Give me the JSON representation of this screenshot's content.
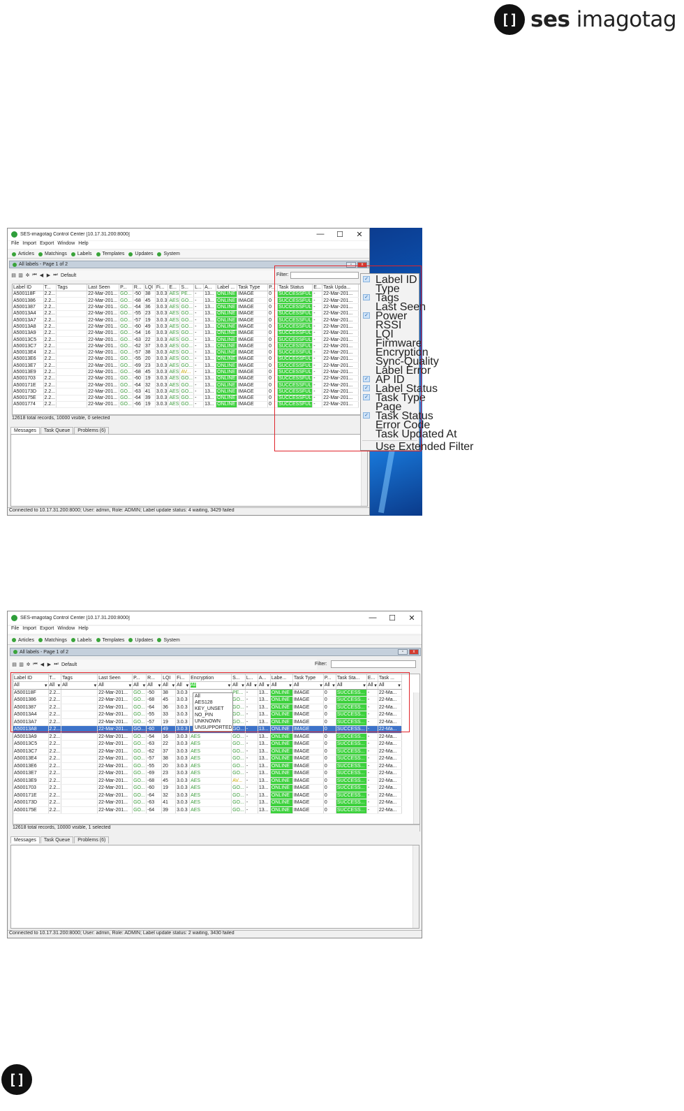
{
  "brand": {
    "mark": "[]",
    "name_bold": "ses",
    "name_rest": " imagotag"
  },
  "window": {
    "title_1": "SES-imagotag Control Center [10.17.31.200:8000]",
    "title_2": "SES-imagotag Control Center [10.17.31.200:8000]",
    "controls": [
      "—",
      "☐",
      "✕"
    ]
  },
  "menu": [
    "File",
    "Import",
    "Export",
    "Window",
    "Help"
  ],
  "nav": [
    "Articles",
    "Matchings",
    "Labels",
    "Templates",
    "Updates",
    "System"
  ],
  "panel": {
    "title": "All labels - Page 1 of 2",
    "filter_label": "Filter:",
    "toolbar_default": "Default"
  },
  "shot1": {
    "columns": [
      "Label ID",
      "T...",
      "Tags",
      "Last Seen",
      "P...",
      "R...",
      "LQI",
      "Fi...",
      "E...",
      "S...",
      "L...",
      "A...",
      "Label ...",
      "Task Type",
      "P...",
      "Task Status",
      "E...",
      "Task Upda..."
    ],
    "rows": [
      [
        "A500118F",
        "2.2...",
        "",
        "22-Mar-201...",
        "GO...",
        "-50",
        "38",
        "3.0.3",
        "AES",
        "PE...",
        "-",
        "13...",
        "ONLINE",
        "IMAGE",
        "0",
        "SUCCESSFUL",
        "-",
        "22-Mar-201..."
      ],
      [
        "A5001386",
        "2.2...",
        "",
        "22-Mar-201...",
        "GO...",
        "-68",
        "45",
        "3.0.3",
        "AES",
        "GO...",
        "-",
        "13...",
        "ONLINE",
        "IMAGE",
        "0",
        "SUCCESSFUL",
        "-",
        "22-Mar-201..."
      ],
      [
        "A5001387",
        "2.2...",
        "",
        "22-Mar-201...",
        "GO...",
        "-64",
        "36",
        "3.0.3",
        "AES",
        "GO...",
        "-",
        "13...",
        "ONLINE",
        "IMAGE",
        "0",
        "SUCCESSFUL",
        "-",
        "22-Mar-201..."
      ],
      [
        "A50013A4",
        "2.2...",
        "",
        "22-Mar-201...",
        "GO...",
        "-55",
        "23",
        "3.0.3",
        "AES",
        "GO...",
        "-",
        "13...",
        "ONLINE",
        "IMAGE",
        "0",
        "SUCCESSFUL",
        "-",
        "22-Mar-201..."
      ],
      [
        "A50013A7",
        "2.2...",
        "",
        "22-Mar-201...",
        "GO...",
        "-57",
        "19",
        "3.0.3",
        "AES",
        "GO...",
        "-",
        "13...",
        "ONLINE",
        "IMAGE",
        "0",
        "SUCCESSFUL",
        "-",
        "22-Mar-201..."
      ],
      [
        "A50013A8",
        "2.2...",
        "",
        "22-Mar-201...",
        "GO...",
        "-60",
        "49",
        "3.0.3",
        "AES",
        "GO...",
        "-",
        "13...",
        "ONLINE",
        "IMAGE",
        "0",
        "SUCCESSFUL",
        "-",
        "22-Mar-201..."
      ],
      [
        "A50013A9",
        "2.2...",
        "",
        "22-Mar-201...",
        "GO...",
        "-54",
        "16",
        "3.0.3",
        "AES",
        "GO...",
        "-",
        "13...",
        "ONLINE",
        "IMAGE",
        "0",
        "SUCCESSFUL",
        "-",
        "22-Mar-201..."
      ],
      [
        "A50013C5",
        "2.2...",
        "",
        "22-Mar-201...",
        "GO...",
        "-63",
        "22",
        "3.0.3",
        "AES",
        "GO...",
        "-",
        "13...",
        "ONLINE",
        "IMAGE",
        "0",
        "SUCCESSFUL",
        "-",
        "22-Mar-201..."
      ],
      [
        "A50013C7",
        "2.2...",
        "",
        "22-Mar-201...",
        "GO...",
        "-62",
        "37",
        "3.0.3",
        "AES",
        "GO...",
        "-",
        "13...",
        "ONLINE",
        "IMAGE",
        "0",
        "SUCCESSFUL",
        "-",
        "22-Mar-201..."
      ],
      [
        "A50013E4",
        "2.2...",
        "",
        "22-Mar-201...",
        "GO...",
        "-57",
        "38",
        "3.0.3",
        "AES",
        "GO...",
        "-",
        "13...",
        "ONLINE",
        "IMAGE",
        "0",
        "SUCCESSFUL",
        "-",
        "22-Mar-201..."
      ],
      [
        "A50013E6",
        "2.2...",
        "",
        "22-Mar-201...",
        "GO...",
        "-55",
        "20",
        "3.0.3",
        "AES",
        "GO...",
        "-",
        "13...",
        "ONLINE",
        "IMAGE",
        "0",
        "SUCCESSFUL",
        "-",
        "22-Mar-201..."
      ],
      [
        "A50013E7",
        "2.2...",
        "",
        "22-Mar-201...",
        "GO...",
        "-69",
        "23",
        "3.0.3",
        "AES",
        "GO...",
        "-",
        "13...",
        "ONLINE",
        "IMAGE",
        "0",
        "SUCCESSFUL",
        "-",
        "22-Mar-201..."
      ],
      [
        "A50013E9",
        "2.2...",
        "",
        "22-Mar-201...",
        "GO...",
        "-68",
        "45",
        "3.0.3",
        "AES",
        "AV...",
        "-",
        "13...",
        "ONLINE",
        "IMAGE",
        "0",
        "SUCCESSFUL",
        "-",
        "22-Mar-201..."
      ],
      [
        "A5001703",
        "2.2...",
        "",
        "22-Mar-201...",
        "GO...",
        "-60",
        "19",
        "3.0.3",
        "AES",
        "GO...",
        "-",
        "13...",
        "ONLINE",
        "IMAGE",
        "0",
        "SUCCESSFUL",
        "-",
        "22-Mar-201..."
      ],
      [
        "A500171E",
        "2.2...",
        "",
        "22-Mar-201...",
        "GO...",
        "-64",
        "32",
        "3.0.3",
        "AES",
        "GO...",
        "-",
        "13...",
        "ONLINE",
        "IMAGE",
        "0",
        "SUCCESSFUL",
        "-",
        "22-Mar-201..."
      ],
      [
        "A500173D",
        "2.2...",
        "",
        "22-Mar-201...",
        "GO...",
        "-63",
        "41",
        "3.0.3",
        "AES",
        "GO...",
        "-",
        "13...",
        "ONLINE",
        "IMAGE",
        "0",
        "SUCCESSFUL",
        "-",
        "22-Mar-201..."
      ],
      [
        "A500175E",
        "2.2...",
        "",
        "22-Mar-201...",
        "GO...",
        "-64",
        "39",
        "3.0.3",
        "AES",
        "GO...",
        "-",
        "13...",
        "ONLINE",
        "IMAGE",
        "0",
        "SUCCESSFUL",
        "-",
        "22-Mar-201..."
      ],
      [
        "A5001774",
        "2.2...",
        "",
        "22-Mar-201...",
        "GO...",
        "-66",
        "19",
        "3.0.3",
        "AES",
        "GO...",
        "-",
        "13...",
        "ONLINE",
        "IMAGE",
        "0",
        "SUCCESSFUL",
        "-",
        "22-Mar-201..."
      ]
    ],
    "records": "12618 total records, 10000 visible, 0 selected",
    "status": "Connected to 10.17.31.200:8000; User: admin, Role: ADMIN; Label update status: 4 waiting, 3429 failed",
    "column_menu": [
      {
        "label": "Label ID",
        "checked": true
      },
      {
        "label": "Type",
        "checked": false
      },
      {
        "label": "Tags",
        "checked": true
      },
      {
        "label": "Last Seen",
        "checked": false
      },
      {
        "label": "Power",
        "checked": true
      },
      {
        "label": "RSSI",
        "checked": false
      },
      {
        "label": "LQI",
        "checked": false
      },
      {
        "label": "Firmware",
        "checked": false
      },
      {
        "label": "Encryption",
        "checked": false
      },
      {
        "label": "Sync-Quality",
        "checked": false
      },
      {
        "label": "Label Error",
        "checked": false
      },
      {
        "label": "AP ID",
        "checked": true
      },
      {
        "label": "Label Status",
        "checked": true
      },
      {
        "label": "Task Type",
        "checked": true
      },
      {
        "label": "Page",
        "checked": false
      },
      {
        "label": "Task Status",
        "checked": true
      },
      {
        "label": "Error Code",
        "checked": false
      },
      {
        "label": "Task Updated At",
        "checked": false
      }
    ],
    "column_menu_extra": "Use Extended Filter"
  },
  "shot2": {
    "columns": [
      "Label ID",
      "T...",
      "Tags",
      "Last Seen",
      "P...",
      "R...",
      "LQI",
      "Fi...",
      "Encryption",
      "S...",
      "L...",
      "A...",
      "Labe...",
      "Task Type",
      "P...",
      "Task Sta...",
      "E...",
      "Task ..."
    ],
    "filter_value": "All",
    "encryption_options": [
      "All",
      "AES128",
      "KEY_UNSET",
      "NO_PIN",
      "UNKNOWN",
      "UNSUPPORTED"
    ],
    "rows": [
      [
        "A500118F",
        "2.2...",
        "",
        "22-Mar-201...",
        "GO...",
        "-50",
        "38",
        "3.0.3",
        "",
        "PE...",
        "-",
        "13...",
        "ONLINE",
        "IMAGE",
        "0",
        "SUCCESS...",
        "-",
        "22-Ma..."
      ],
      [
        "A5001386",
        "2.2...",
        "",
        "22-Mar-201...",
        "GO...",
        "-68",
        "45",
        "3.0.3",
        "",
        "GO...",
        "-",
        "13...",
        "ONLINE",
        "IMAGE",
        "0",
        "SUCCESS...",
        "-",
        "22-Ma..."
      ],
      [
        "A5001387",
        "2.2...",
        "",
        "22-Mar-201...",
        "GO...",
        "-64",
        "36",
        "3.0.3",
        "",
        "GO...",
        "-",
        "13...",
        "ONLINE",
        "IMAGE",
        "0",
        "SUCCESS...",
        "-",
        "22-Ma..."
      ],
      [
        "A50013A4",
        "2.2...",
        "",
        "22-Mar-201...",
        "GO...",
        "-55",
        "33",
        "3.0.3",
        "",
        "GO...",
        "-",
        "13...",
        "ONLINE",
        "IMAGE",
        "0",
        "SUCCESS...",
        "-",
        "22-Ma..."
      ],
      [
        "A50013A7",
        "2.2...",
        "",
        "22-Mar-201...",
        "GO...",
        "-57",
        "19",
        "3.0.3",
        "",
        "GO...",
        "-",
        "13...",
        "ONLINE",
        "IMAGE",
        "0",
        "SUCCESS...",
        "-",
        "22-Ma..."
      ],
      [
        "A50013A8",
        "2.2...",
        "",
        "22-Mar-201...",
        "GO...",
        "-60",
        "49",
        "3.0.3",
        "",
        "GO...",
        "-",
        "13...",
        "ONLINE",
        "IMAGE",
        "0",
        "SUCCESS...",
        "-",
        "22-Ma..."
      ],
      [
        "A50013A9",
        "2.2...",
        "",
        "22-Mar-201...",
        "GO...",
        "-54",
        "16",
        "3.0.3",
        "AES",
        "GO...",
        "-",
        "13...",
        "ONLINE",
        "IMAGE",
        "0",
        "SUCCESS...",
        "-",
        "22-Ma..."
      ],
      [
        "A50013C5",
        "2.2...",
        "",
        "22-Mar-201...",
        "GO...",
        "-63",
        "22",
        "3.0.3",
        "AES",
        "GO...",
        "-",
        "13...",
        "ONLINE",
        "IMAGE",
        "0",
        "SUCCESS...",
        "-",
        "22-Ma..."
      ],
      [
        "A50013C7",
        "2.2...",
        "",
        "22-Mar-201...",
        "GO...",
        "-62",
        "37",
        "3.0.3",
        "AES",
        "GO...",
        "-",
        "13...",
        "ONLINE",
        "IMAGE",
        "0",
        "SUCCESS...",
        "-",
        "22-Ma..."
      ],
      [
        "A50013E4",
        "2.2...",
        "",
        "22-Mar-201...",
        "GO...",
        "-57",
        "38",
        "3.0.3",
        "AES",
        "GO...",
        "-",
        "13...",
        "ONLINE",
        "IMAGE",
        "0",
        "SUCCESS...",
        "-",
        "22-Ma..."
      ],
      [
        "A50013E6",
        "2.2...",
        "",
        "22-Mar-201...",
        "GO...",
        "-55",
        "20",
        "3.0.3",
        "AES",
        "GO...",
        "-",
        "13...",
        "ONLINE",
        "IMAGE",
        "0",
        "SUCCESS...",
        "-",
        "22-Ma..."
      ],
      [
        "A50013E7",
        "2.2...",
        "",
        "22-Mar-201...",
        "GO...",
        "-69",
        "23",
        "3.0.3",
        "AES",
        "GO...",
        "-",
        "13...",
        "ONLINE",
        "IMAGE",
        "0",
        "SUCCESS...",
        "-",
        "22-Ma..."
      ],
      [
        "A50013E9",
        "2.2...",
        "",
        "22-Mar-201...",
        "GO...",
        "-68",
        "45",
        "3.0.3",
        "AES",
        "AV...",
        "-",
        "13...",
        "ONLINE",
        "IMAGE",
        "0",
        "SUCCESS...",
        "-",
        "22-Ma..."
      ],
      [
        "A5001703",
        "2.2...",
        "",
        "22-Mar-201...",
        "GO...",
        "-60",
        "19",
        "3.0.3",
        "AES",
        "GO...",
        "-",
        "13...",
        "ONLINE",
        "IMAGE",
        "0",
        "SUCCESS...",
        "-",
        "22-Ma..."
      ],
      [
        "A500171E",
        "2.2...",
        "",
        "22-Mar-201...",
        "GO...",
        "-64",
        "32",
        "3.0.3",
        "AES",
        "GO...",
        "-",
        "13...",
        "ONLINE",
        "IMAGE",
        "0",
        "SUCCESS...",
        "-",
        "22-Ma..."
      ],
      [
        "A500173D",
        "2.2...",
        "",
        "22-Mar-201...",
        "GO...",
        "-63",
        "41",
        "3.0.3",
        "AES",
        "GO...",
        "-",
        "13...",
        "ONLINE",
        "IMAGE",
        "0",
        "SUCCESS...",
        "-",
        "22-Ma..."
      ],
      [
        "A500175E",
        "2.2...",
        "",
        "22-Mar-201...",
        "GO...",
        "-64",
        "39",
        "3.0.3",
        "AES",
        "GO...",
        "-",
        "13...",
        "ONLINE",
        "IMAGE",
        "0",
        "SUCCESS...",
        "-",
        "22-Ma..."
      ]
    ],
    "selected_row": 5,
    "records": "12618 total records, 10000 visible, 1 selected",
    "status": "Connected to 10.17.31.200:8000; User: admin, Role: ADMIN; Label update status: 2 waiting, 3430 failed"
  },
  "bottom_tabs": [
    "Messages",
    "Task Queue",
    "Problems (6)"
  ],
  "colors": {
    "online_green": "#3dd13d",
    "highlight_red": "#e0242b",
    "status_dot": "#3aa43a"
  }
}
